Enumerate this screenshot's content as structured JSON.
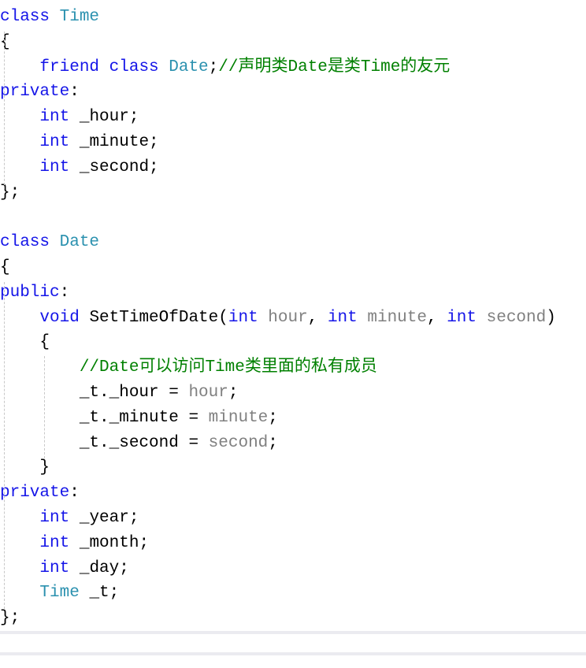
{
  "editor": {
    "lines": [
      [
        [
          "kw",
          "class "
        ],
        [
          "ty",
          "Time"
        ]
      ],
      [
        [
          "tx",
          "{"
        ]
      ],
      [
        [
          "tx",
          "    "
        ],
        [
          "kw",
          "friend class "
        ],
        [
          "ty",
          "Date"
        ],
        [
          "tx",
          ";"
        ],
        [
          "cm",
          "//声明类Date是类Time的友元"
        ]
      ],
      [
        [
          "kw",
          "private"
        ],
        [
          "tx",
          ":"
        ]
      ],
      [
        [
          "tx",
          "    "
        ],
        [
          "kw",
          "int"
        ],
        [
          "tx",
          " _hour;"
        ]
      ],
      [
        [
          "tx",
          "    "
        ],
        [
          "kw",
          "int"
        ],
        [
          "tx",
          " _minute;"
        ]
      ],
      [
        [
          "tx",
          "    "
        ],
        [
          "kw",
          "int"
        ],
        [
          "tx",
          " _second;"
        ]
      ],
      [
        [
          "tx",
          "};"
        ]
      ],
      [],
      [
        [
          "kw",
          "class "
        ],
        [
          "ty",
          "Date"
        ]
      ],
      [
        [
          "tx",
          "{"
        ]
      ],
      [
        [
          "kw",
          "public"
        ],
        [
          "tx",
          ":"
        ]
      ],
      [
        [
          "tx",
          "    "
        ],
        [
          "kw",
          "void "
        ],
        [
          "tx",
          "SetTimeOfDate("
        ],
        [
          "kw",
          "int "
        ],
        [
          "pm",
          "hour"
        ],
        [
          "tx",
          ", "
        ],
        [
          "kw",
          "int "
        ],
        [
          "pm",
          "minute"
        ],
        [
          "tx",
          ", "
        ],
        [
          "kw",
          "int "
        ],
        [
          "pm",
          "second"
        ],
        [
          "tx",
          ")"
        ]
      ],
      [
        [
          "tx",
          "    {"
        ]
      ],
      [
        [
          "tx",
          "        "
        ],
        [
          "cm",
          "//Date可以访问Time类里面的私有成员"
        ]
      ],
      [
        [
          "tx",
          "        _t._hour = "
        ],
        [
          "pm",
          "hour"
        ],
        [
          "tx",
          ";"
        ]
      ],
      [
        [
          "tx",
          "        _t._minute = "
        ],
        [
          "pm",
          "minute"
        ],
        [
          "tx",
          ";"
        ]
      ],
      [
        [
          "tx",
          "        _t._second = "
        ],
        [
          "pm",
          "second"
        ],
        [
          "tx",
          ";"
        ]
      ],
      [
        [
          "tx",
          "    }"
        ]
      ],
      [
        [
          "kw",
          "private"
        ],
        [
          "tx",
          ":"
        ]
      ],
      [
        [
          "tx",
          "    "
        ],
        [
          "kw",
          "int"
        ],
        [
          "tx",
          " _year;"
        ]
      ],
      [
        [
          "tx",
          "    "
        ],
        [
          "kw",
          "int"
        ],
        [
          "tx",
          " _month;"
        ]
      ],
      [
        [
          "tx",
          "    "
        ],
        [
          "kw",
          "int"
        ],
        [
          "tx",
          " _day;"
        ]
      ],
      [
        [
          "tx",
          "    "
        ],
        [
          "ty",
          "Time"
        ],
        [
          "tx",
          " _t;"
        ]
      ],
      [
        [
          "tx",
          "};"
        ]
      ]
    ]
  },
  "colors": {
    "keyword": "#1515e8",
    "type": "#2b91af",
    "comment": "#008000",
    "parameter": "#808080"
  }
}
